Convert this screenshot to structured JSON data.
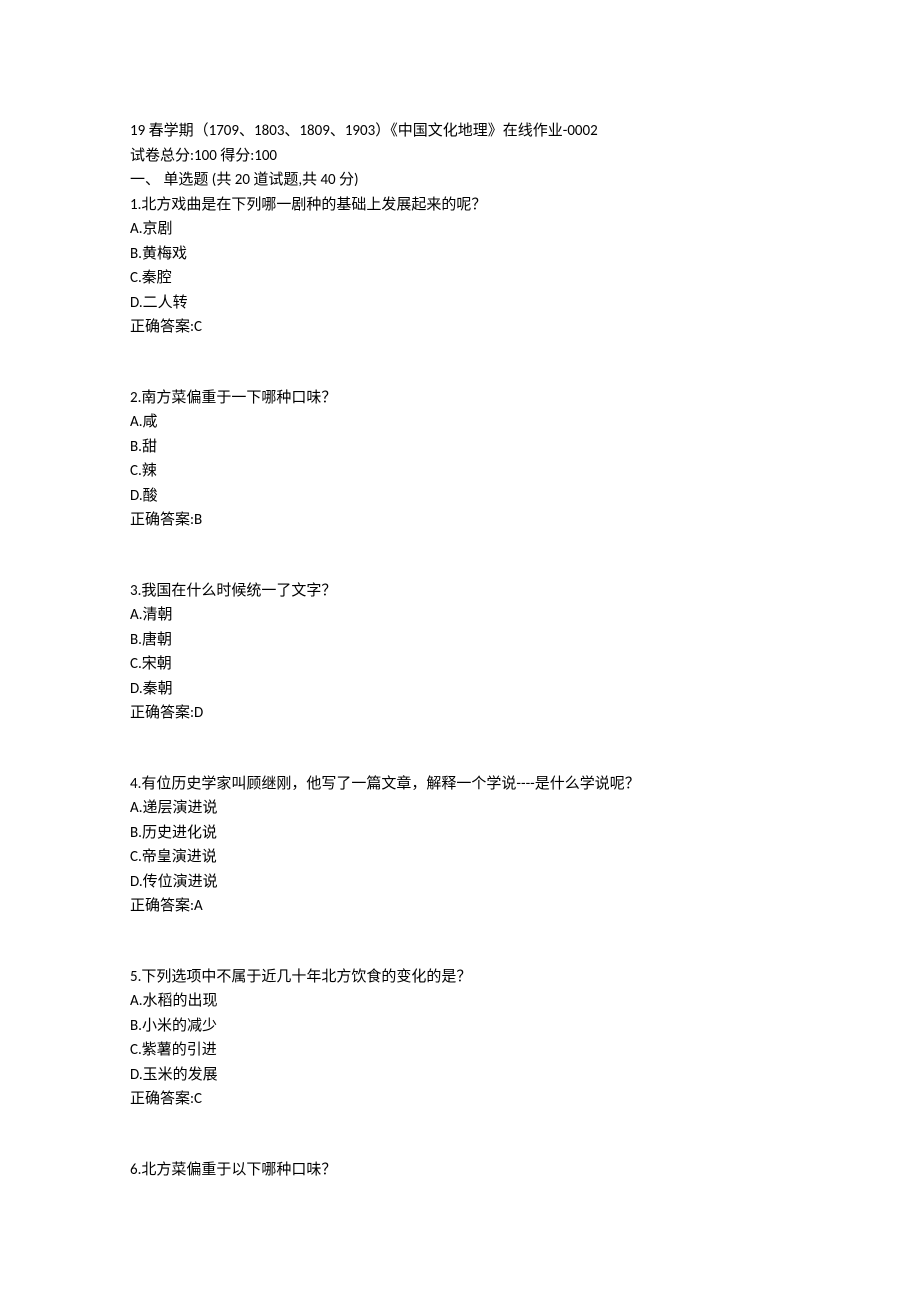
{
  "header": {
    "title": "19 春学期（1709、1803、1809、1903）《中国文化地理》在线作业-0002",
    "score_line": "试卷总分:100       得分:100",
    "section": "一、  单选题  (共  20  道试题,共  40  分)"
  },
  "questions": [
    {
      "num": "1",
      "text": "北方戏曲是在下列哪一剧种的基础上发展起来的呢？",
      "options": [
        {
          "letter": "A",
          "text": "京剧"
        },
        {
          "letter": "B",
          "text": "黄梅戏"
        },
        {
          "letter": "C",
          "text": "秦腔"
        },
        {
          "letter": "D",
          "text": "二人转"
        }
      ],
      "answer": "C"
    },
    {
      "num": "2",
      "text": "南方菜偏重于一下哪种口味？",
      "options": [
        {
          "letter": "A",
          "text": "咸"
        },
        {
          "letter": "B",
          "text": "甜"
        },
        {
          "letter": "C",
          "text": "辣"
        },
        {
          "letter": "D",
          "text": "酸"
        }
      ],
      "answer": "B"
    },
    {
      "num": "3",
      "text": "我国在什么时候统一了文字？",
      "options": [
        {
          "letter": "A",
          "text": "清朝"
        },
        {
          "letter": "B",
          "text": "唐朝"
        },
        {
          "letter": "C",
          "text": "宋朝"
        },
        {
          "letter": "D",
          "text": "秦朝"
        }
      ],
      "answer": "D"
    },
    {
      "num": "4",
      "text": "有位历史学家叫顾继刚，他写了一篇文章，解释一个学说----是什么学说呢？",
      "options": [
        {
          "letter": "A",
          "text": "递层演进说"
        },
        {
          "letter": "B",
          "text": "历史进化说"
        },
        {
          "letter": "C",
          "text": "帝皇演进说"
        },
        {
          "letter": "D",
          "text": "传位演进说"
        }
      ],
      "answer": "A"
    },
    {
      "num": "5",
      "text": "下列选项中不属于近几十年北方饮食的变化的是？",
      "options": [
        {
          "letter": "A",
          "text": "水稻的出现"
        },
        {
          "letter": "B",
          "text": "小米的减少"
        },
        {
          "letter": "C",
          "text": "紫薯的引进"
        },
        {
          "letter": "D",
          "text": "玉米的发展"
        }
      ],
      "answer": "C"
    },
    {
      "num": "6",
      "text": "北方菜偏重于以下哪种口味？",
      "options": [],
      "answer": null
    }
  ],
  "answer_prefix": "正确答案:"
}
